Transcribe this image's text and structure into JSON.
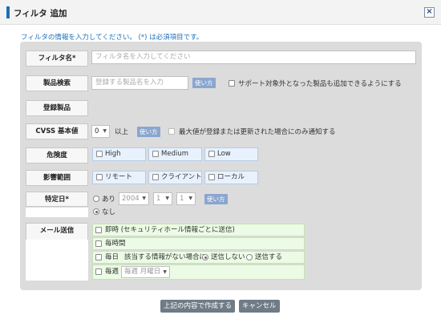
{
  "dialog": {
    "title": "フィルタ 追加",
    "close_label": "×",
    "instruction": "フィルタの情報を入力してください。 (*) は必須項目です。"
  },
  "form": {
    "filter_name": {
      "label": "フィルタ名*",
      "placeholder": "フィルタ名を入力してください"
    },
    "product_search": {
      "label": "製品検索",
      "placeholder": "登録する製品名を入力",
      "use_button": "使い方",
      "support_checkbox": "サポート対象外となった製品も追加できるようにする"
    },
    "registered_products": {
      "label": "登録製品"
    },
    "cvss": {
      "label": "CVSS 基本値",
      "value": "0",
      "suffix": "以上",
      "use_button": "使い方",
      "max_checkbox": "最大値が登録または更新された場合にのみ通知する"
    },
    "severity": {
      "label": "危険度",
      "options": [
        "High",
        "Medium",
        "Low"
      ]
    },
    "scope": {
      "label": "影響範囲",
      "options": [
        "リモート",
        "クライアント",
        "ローカル"
      ]
    },
    "specific_date": {
      "label": "特定日*",
      "radio_yes": "あり",
      "year": "2004",
      "month": "1",
      "day": "1",
      "use_button": "使い方",
      "radio_no": "なし"
    },
    "mail": {
      "label": "メール送信",
      "immediate": "即時 (セキュリティホール情報ごとに送信)",
      "hourly": "毎時間",
      "daily": "毎日",
      "daily_desc": "該当する情報がない場合に",
      "no_send": "送信しない",
      "send": "送信する",
      "weekly": "毎週",
      "weekday": "毎週 月曜日"
    }
  },
  "footer": {
    "create_button": "上記の内容で作成する",
    "cancel_button": "キャンセル"
  }
}
